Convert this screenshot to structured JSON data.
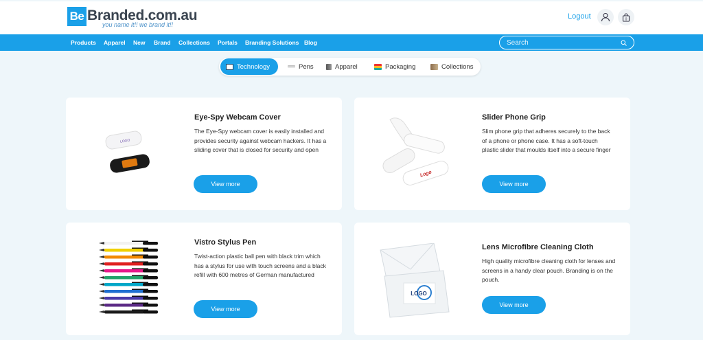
{
  "brand": {
    "logo_mark": "Be",
    "name": "Branded.com.au",
    "tagline": "you name it!! we brand it!!"
  },
  "header": {
    "logout_label": "Logout",
    "icons": [
      "user-icon",
      "cart-icon"
    ]
  },
  "nav": {
    "items": [
      "Products",
      "Apparel",
      "New",
      "Brand",
      "Collections",
      "Portals",
      "Branding Solutions",
      "Blog"
    ],
    "search_placeholder": "Search"
  },
  "tabs": [
    {
      "label": "Technology",
      "active": true
    },
    {
      "label": "Pens",
      "active": false
    },
    {
      "label": "Apparel",
      "active": false
    },
    {
      "label": "Packaging",
      "active": false
    },
    {
      "label": "Collections",
      "active": false
    }
  ],
  "products": [
    {
      "title": "Eye-Spy Webcam Cover",
      "description": "The Eye-Spy webcam cover is easily installed and provides security against webcam hackers. It has a sliding cover that is closed for security and open",
      "button_label": "View more"
    },
    {
      "title": "Slider Phone Grip",
      "description": "Slim phone grip that adheres securely to the back of a phone or phone case. It has a soft-touch plastic slider that moulds itself into a secure finger",
      "button_label": "View more"
    },
    {
      "title": "Vistro Stylus Pen",
      "description": "Twist-action plastic ball pen with black trim which has a stylus for use with touch screens and a black refill with 600 metres of German manufactured",
      "button_label": "View more"
    },
    {
      "title": "Lens Microfibre Cleaning Cloth",
      "description": "High quality microfibre cleaning cloth for lenses and screens in a handy clear pouch. Branding is on the pouch.",
      "button_label": "View more"
    }
  ],
  "colors": {
    "accent": "#1aa0e8",
    "background": "#eef6fa",
    "card": "#ffffff"
  }
}
